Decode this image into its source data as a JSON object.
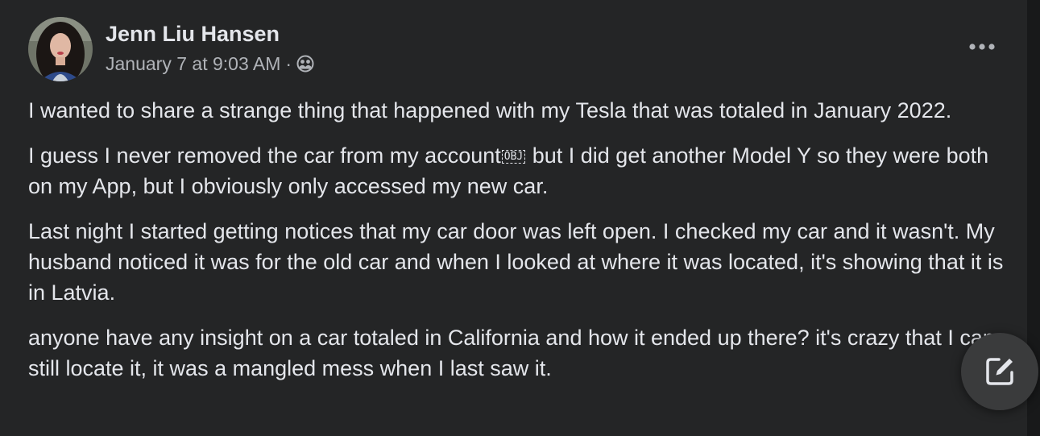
{
  "post": {
    "author_name": "Jenn Liu Hansen",
    "timestamp": "January 7 at 9:03 AM",
    "meta_separator": "·",
    "audience_icon": "friends-icon",
    "more_icon": "more-horizontal-icon",
    "paragraphs": {
      "p1": "I wanted to share a strange thing that happened with my Tesla that was totaled in January 2022.",
      "p2_before": "I guess I never removed the car from my account",
      "p2_glyph": "OBJ",
      "p2_after": " but I did get another Model Y so they were both on my App, but I obviously only accessed my new car.",
      "p3": "Last night I started getting notices that my car door was left open. I checked my car and it wasn't. My husband noticed it was for the old car and when I looked at where it was located, it's showing that it is in Latvia.",
      "p4": "anyone have any insight on a car totaled in California and how it ended up there? it's crazy that I can still locate it, it was a mangled mess when I last saw it."
    }
  },
  "floating_action": {
    "icon": "compose-icon"
  },
  "colors": {
    "page_background": "#18191a",
    "card_background": "#242526",
    "primary_text": "#e4e6eb",
    "secondary_text": "#b0b3b8",
    "fab_background": "#3a3b3c"
  }
}
